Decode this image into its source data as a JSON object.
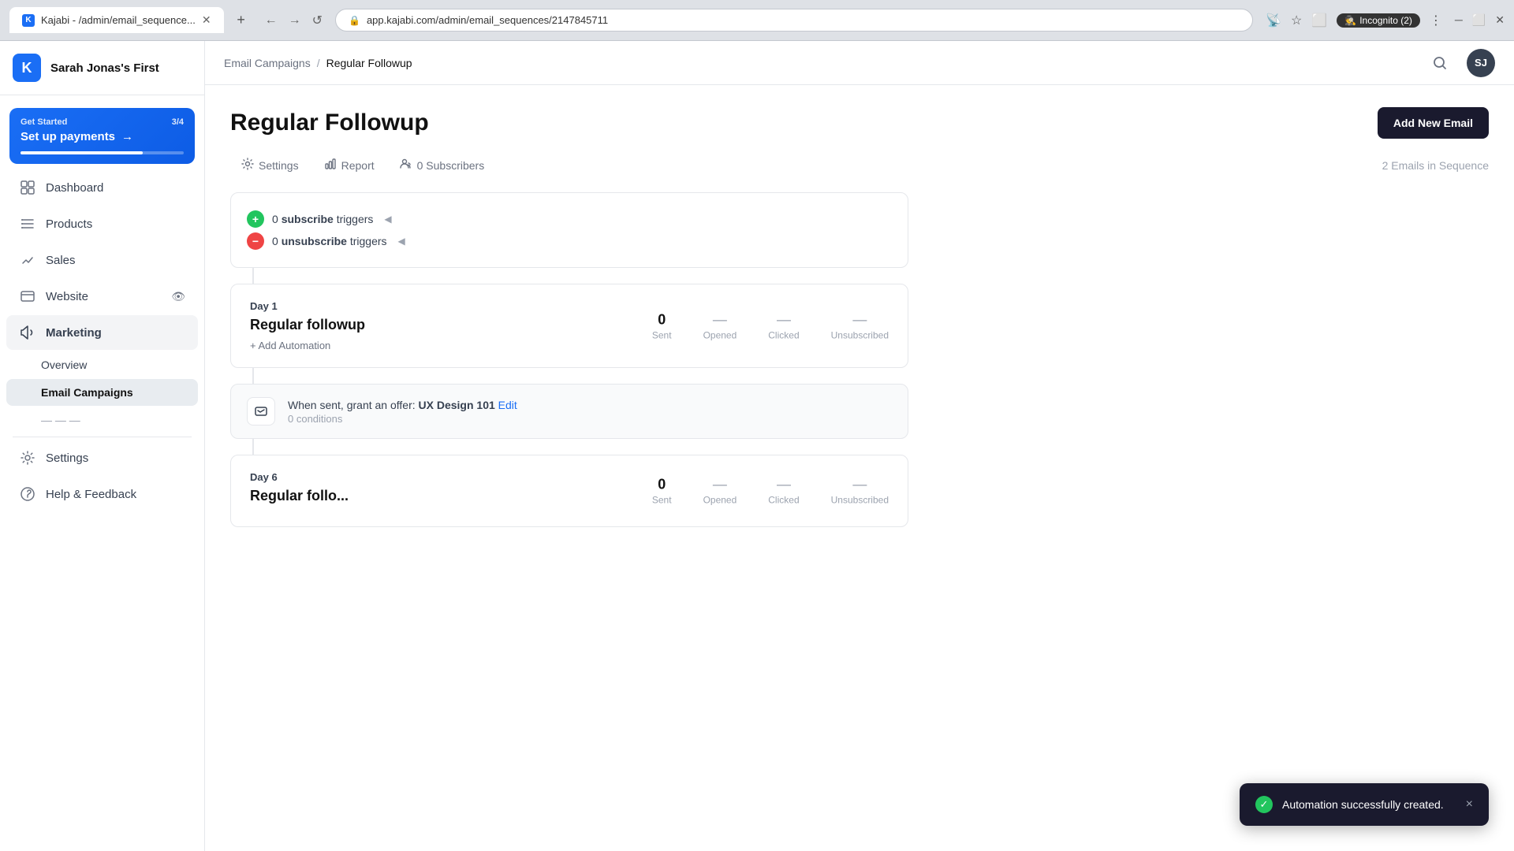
{
  "browser": {
    "tab_title": "Kajabi - /admin/email_sequence...",
    "tab_favicon": "K",
    "url": "app.kajabi.com/admin/email_sequences/2147845711",
    "incognito_label": "Incognito (2)"
  },
  "sidebar": {
    "logo_letter": "K",
    "org_name": "Sarah Jonas's First",
    "setup_banner": {
      "label": "Get Started",
      "progress": "3/4",
      "title": "Set up payments",
      "arrow": "→"
    },
    "nav_items": [
      {
        "id": "dashboard",
        "label": "Dashboard",
        "icon": "⌂"
      },
      {
        "id": "products",
        "label": "Products",
        "icon": "◻"
      },
      {
        "id": "sales",
        "label": "Sales",
        "icon": "◇"
      },
      {
        "id": "website",
        "label": "Website",
        "icon": "◫"
      },
      {
        "id": "marketing",
        "label": "Marketing",
        "icon": "◈"
      }
    ],
    "sub_nav_items": [
      {
        "id": "overview",
        "label": "Overview"
      },
      {
        "id": "email_campaigns",
        "label": "Email Campaigns",
        "active": true
      }
    ],
    "bottom_nav": [
      {
        "id": "settings",
        "label": "Settings",
        "icon": "⚙"
      },
      {
        "id": "help",
        "label": "Help & Feedback",
        "icon": "?"
      }
    ]
  },
  "topbar": {
    "breadcrumb_parent": "Email Campaigns",
    "breadcrumb_separator": "/",
    "breadcrumb_current": "Regular Followup",
    "avatar_initials": "SJ"
  },
  "page": {
    "title": "Regular Followup",
    "add_email_button": "Add New Email",
    "emails_in_sequence": "2 Emails in Sequence",
    "tabs": [
      {
        "id": "settings",
        "label": "Settings",
        "icon": "⚙"
      },
      {
        "id": "report",
        "label": "Report",
        "icon": "📊"
      },
      {
        "id": "subscribers",
        "label": "0 Subscribers",
        "icon": "👤"
      }
    ],
    "triggers": [
      {
        "type": "subscribe",
        "count": "0",
        "label": "subscribe",
        "suffix": "triggers"
      },
      {
        "type": "unsubscribe",
        "count": "0",
        "label": "unsubscribe",
        "suffix": "triggers"
      }
    ],
    "sequence_items": [
      {
        "day_label": "Day",
        "day_number": "1",
        "email_title": "Regular followup",
        "add_automation_label": "+ Add Automation",
        "stats": {
          "sent_value": "0",
          "sent_label": "Sent",
          "opened_value": "—",
          "opened_label": "Opened",
          "clicked_value": "—",
          "clicked_label": "Clicked",
          "unsubscribed_value": "—",
          "unsubscribed_label": "Unsubscribed"
        },
        "automation": {
          "text_prefix": "When sent, grant an offer:",
          "offer_name": "UX Design 101",
          "edit_label": "Edit",
          "conditions": "0 conditions"
        }
      },
      {
        "day_label": "Day",
        "day_number": "6",
        "email_title": "Regular follo...",
        "stats": {
          "sent_value": "0",
          "sent_label": "Sent",
          "opened_value": "—",
          "opened_label": "Opened",
          "clicked_value": "—",
          "clicked_label": "Clicked",
          "unsubscribed_value": "—",
          "unsubscribed_label": "Unsubscribed"
        }
      }
    ]
  },
  "toast": {
    "message": "Automation successfully created.",
    "close": "×"
  }
}
